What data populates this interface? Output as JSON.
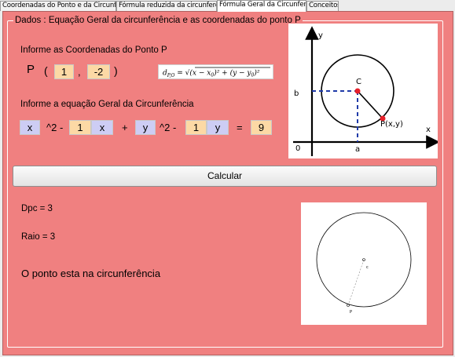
{
  "tabs": [
    {
      "label": "Coordenadas do Ponto e da Circunferência",
      "active": false
    },
    {
      "label": "Fórmula reduzida da circunferência",
      "active": false
    },
    {
      "label": "Fórmula Geral da Circunferência",
      "active": true
    },
    {
      "label": "Conceitos",
      "active": false
    }
  ],
  "group_title": "Dados : Equação Geral da circunferência e as coordenadas do ponto P",
  "point_section": {
    "label": "Informe as Coordenadas do Ponto P",
    "p_letter": "P",
    "open_paren": "(",
    "comma": ",",
    "close_paren": ")",
    "x_value": "1",
    "y_value": "-2"
  },
  "distance_formula": "dP,O = √((x − x₀)² + (y − y₀)²)",
  "equation_section": {
    "label": "Informe a equação Geral da Circunferência",
    "x_var": "x",
    "pow1": "^2 -",
    "coef_x": "1",
    "x_var2": "x",
    "plus": "+",
    "y_var": "y",
    "pow2": "^2 -",
    "coef_y": "1",
    "y_var2": "y",
    "equals": "=",
    "rhs": "9"
  },
  "diagram": {
    "y_axis": "y",
    "x_axis": "x",
    "origin": "0",
    "center_label": "C",
    "point_label": "P(x,y)",
    "b_label": "b",
    "a_label": "a",
    "center_color": "#e8202a",
    "dash_color": "#1f3aa8"
  },
  "calculate_button": "Calcular",
  "results": {
    "dpc": "Dpc =  3",
    "raio": "Raio = 3",
    "message": "O ponto esta na circunferência"
  },
  "plot": {
    "center_label": "c",
    "point_label": "P"
  },
  "colors": {
    "panel": "#f08080",
    "orange_box": "#fcd9a5",
    "purple_box": "#cdcdf4"
  }
}
